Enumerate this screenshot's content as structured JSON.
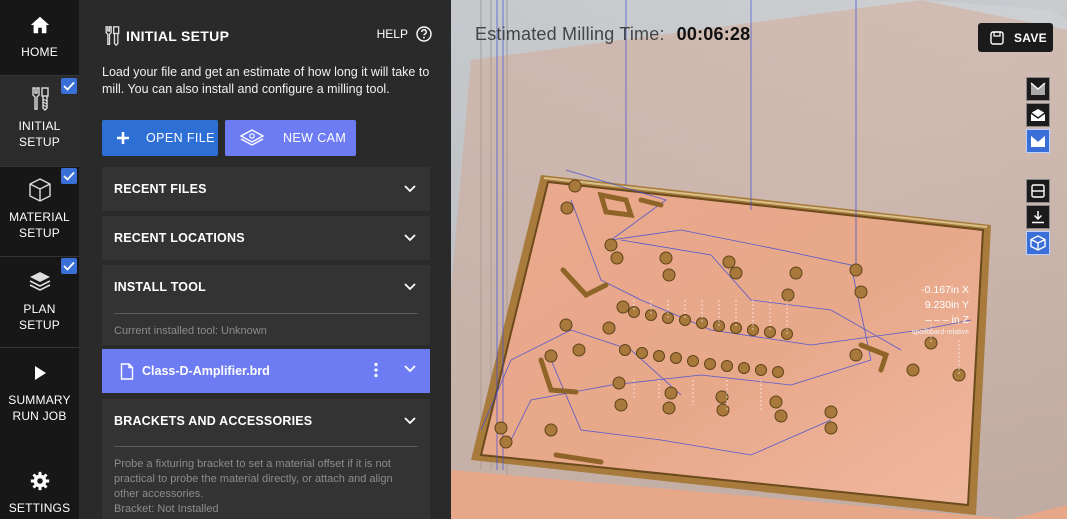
{
  "nav": {
    "home": "HOME",
    "initial_setup": [
      "INITIAL",
      "SETUP"
    ],
    "material_setup": [
      "MATERIAL",
      "SETUP"
    ],
    "plan_setup": [
      "PLAN",
      "SETUP"
    ],
    "summary": [
      "SUMMARY",
      "RUN JOB"
    ],
    "settings": "SETTINGS"
  },
  "panel": {
    "title": "INITIAL SETUP",
    "help": "HELP",
    "description": "Load your file and get an estimate of how long it will take to mill. You can also install and configure a milling tool.",
    "open_file": "OPEN FILE",
    "new_cam": "NEW CAM",
    "recent_files": "RECENT FILES",
    "recent_locations": "RECENT LOCATIONS",
    "install_tool": "INSTALL TOOL",
    "current_tool": "Current installed tool: Unknown",
    "file_name": "Class-D-Amplifier.brd",
    "brackets": "BRACKETS AND ACCESSORIES",
    "brackets_desc": "Probe a fixturing bracket to set a material offset if it is not practical to probe the material directly, or attach and align other accessories.",
    "bracket_status": "Bracket: Not Installed"
  },
  "viewport": {
    "est_label": "Estimated Milling Time:",
    "est_time": "00:06:28",
    "save": "SAVE",
    "coords": {
      "x": "-0.167in X",
      "y": "9.230in Y",
      "z": "– – – in Z",
      "note": "spoilboard-relative"
    }
  },
  "colors": {
    "accent_blue": "#2e6fd6",
    "accent_purple": "#6d7cf2",
    "board_copper": "#e6a487",
    "trace": "#3b4bd8"
  }
}
